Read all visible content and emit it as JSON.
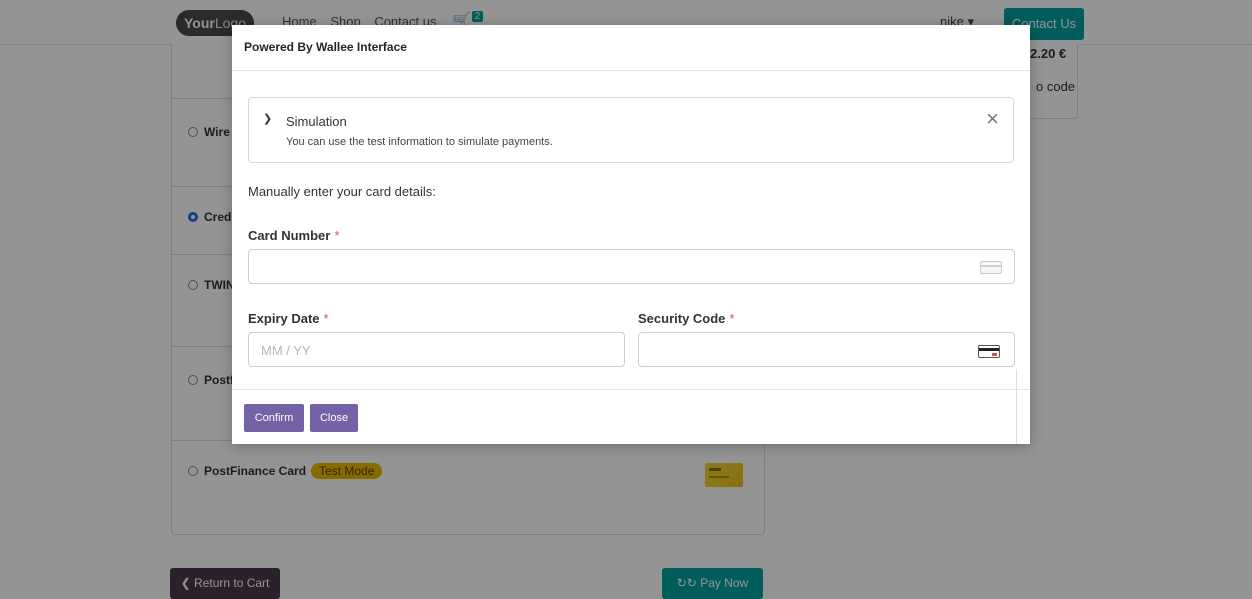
{
  "navbar": {
    "logo_bold": "Your",
    "logo_rest": "Logo",
    "links": [
      "Home",
      "Shop",
      "Contact us"
    ],
    "cart_count": "2",
    "user": "nike ▾",
    "contact_button": "Contact Us"
  },
  "summary": {
    "total": "2.20 €",
    "promo": "o code"
  },
  "payment_methods": [
    {
      "label": "Wire",
      "selected": false
    },
    {
      "label": "Cred",
      "selected": true
    },
    {
      "label": "TWIN",
      "selected": false
    },
    {
      "label": "Postf",
      "selected": false
    },
    {
      "label": "PostFinance Card",
      "selected": false,
      "badge": "Test Mode"
    }
  ],
  "footer_actions": {
    "return_label": "Return to Cart",
    "pay_label": "Pay Now"
  },
  "modal": {
    "title": "Powered By Wallee Interface",
    "simulation": {
      "title": "Simulation",
      "description": "You can use the test information to simulate payments."
    },
    "instructions": "Manually enter your card details:",
    "card_number": {
      "label": "Card Number",
      "required": "*",
      "value": ""
    },
    "expiry": {
      "label": "Expiry Date",
      "required": "*",
      "placeholder": "MM / YY"
    },
    "security_code": {
      "label": "Security Code",
      "required": "*",
      "value": ""
    },
    "confirm_label": "Confirm",
    "close_label": "Close"
  },
  "icons": {
    "chevron": "chevron-down-icon",
    "close": "close-icon",
    "card": "credit-card-icon",
    "cvc": "cvc-card-icon",
    "cart": "cart-icon",
    "refresh": "refresh-icon",
    "back": "chevron-left-icon"
  },
  "colors": {
    "primary": "#00a09d",
    "modal_button": "#7461a6",
    "return_button": "#4b3a4a",
    "test_badge": "#e6b800",
    "required": "#d9534f"
  }
}
